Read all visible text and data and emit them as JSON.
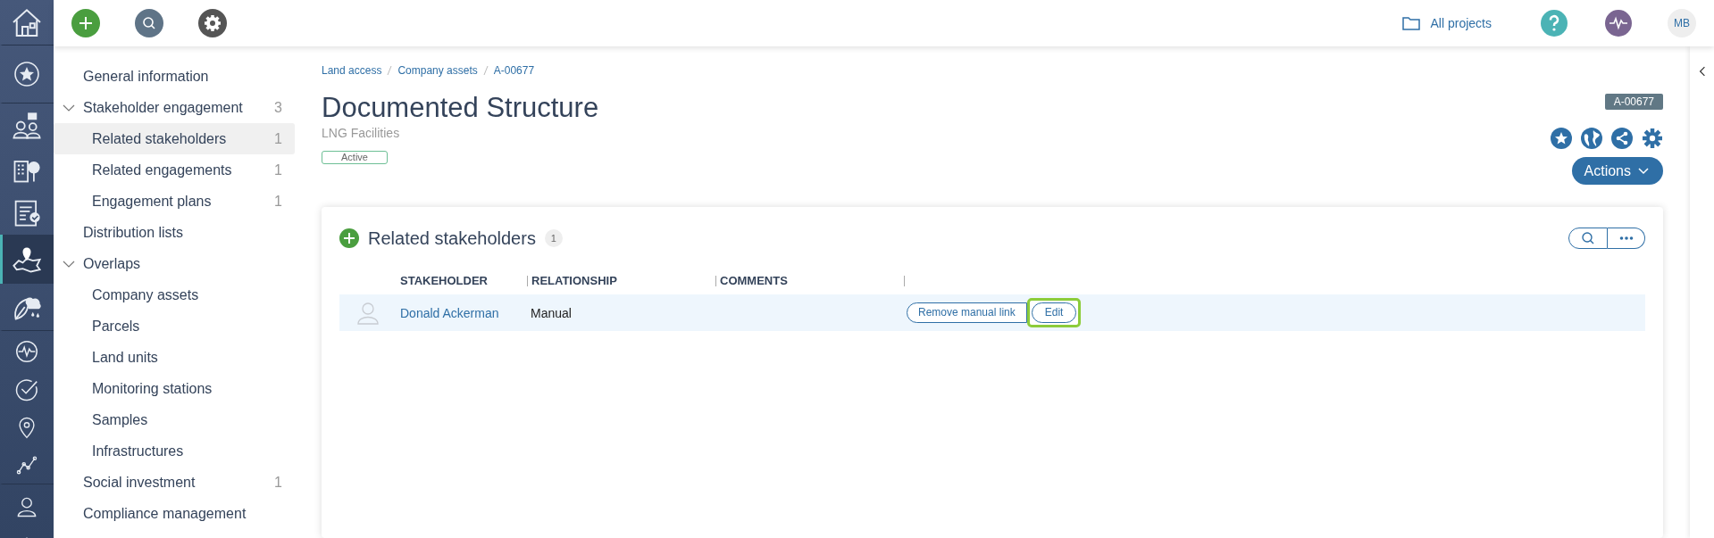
{
  "rail_items": [
    {
      "selected": false
    },
    {
      "selected": false
    },
    {
      "selected": false
    },
    {
      "selected": false
    },
    {
      "selected": false
    },
    {
      "selected": true
    },
    {
      "selected": false
    },
    {
      "selected": false
    },
    {
      "selected": false
    },
    {
      "selected": false
    },
    {
      "selected": false
    },
    {
      "selected": false
    },
    {
      "selected": false
    }
  ],
  "topbar": {
    "projects_link": "All projects",
    "user_initials": "MB"
  },
  "sidebar": {
    "items": [
      {
        "label": "General information",
        "selected": false
      },
      {
        "label": "Stakeholder engagement",
        "count": "3",
        "expanded": true,
        "selected": false,
        "children": [
          {
            "label": "Related stakeholders",
            "count": "1",
            "selected": true
          },
          {
            "label": "Related engagements",
            "count": "1",
            "selected": false
          },
          {
            "label": "Engagement plans",
            "count": "1",
            "selected": false
          }
        ]
      },
      {
        "label": "Distribution lists",
        "selected": false
      },
      {
        "label": "Overlaps",
        "expanded": true,
        "selected": false,
        "children": [
          {
            "label": "Company assets",
            "selected": false
          },
          {
            "label": "Parcels",
            "selected": false
          },
          {
            "label": "Land units",
            "selected": false
          },
          {
            "label": "Monitoring stations",
            "selected": false
          },
          {
            "label": "Samples",
            "selected": false
          },
          {
            "label": "Infrastructures",
            "selected": false
          }
        ]
      },
      {
        "label": "Social investment",
        "count": "1",
        "selected": false
      },
      {
        "label": "Compliance management",
        "selected": false
      }
    ]
  },
  "breadcrumbs": [
    "Land access",
    "Company assets",
    "A-00677"
  ],
  "record": {
    "title": "Documented Structure",
    "subtitle": "LNG Facilities",
    "status": "Active",
    "record_id": "A-00677",
    "actions_button": "Actions"
  },
  "section": {
    "title": "Related stakeholders",
    "count": "1",
    "columns": [
      "STAKEHOLDER",
      "RELATIONSHIP",
      "COMMENTS"
    ],
    "rows": [
      {
        "stakeholder": "Donald Ackerman",
        "relationship": "Manual",
        "buttons": [
          {
            "label": "Remove manual link",
            "highlighted": false
          },
          {
            "label": "Edit",
            "highlighted": true
          }
        ]
      }
    ]
  }
}
